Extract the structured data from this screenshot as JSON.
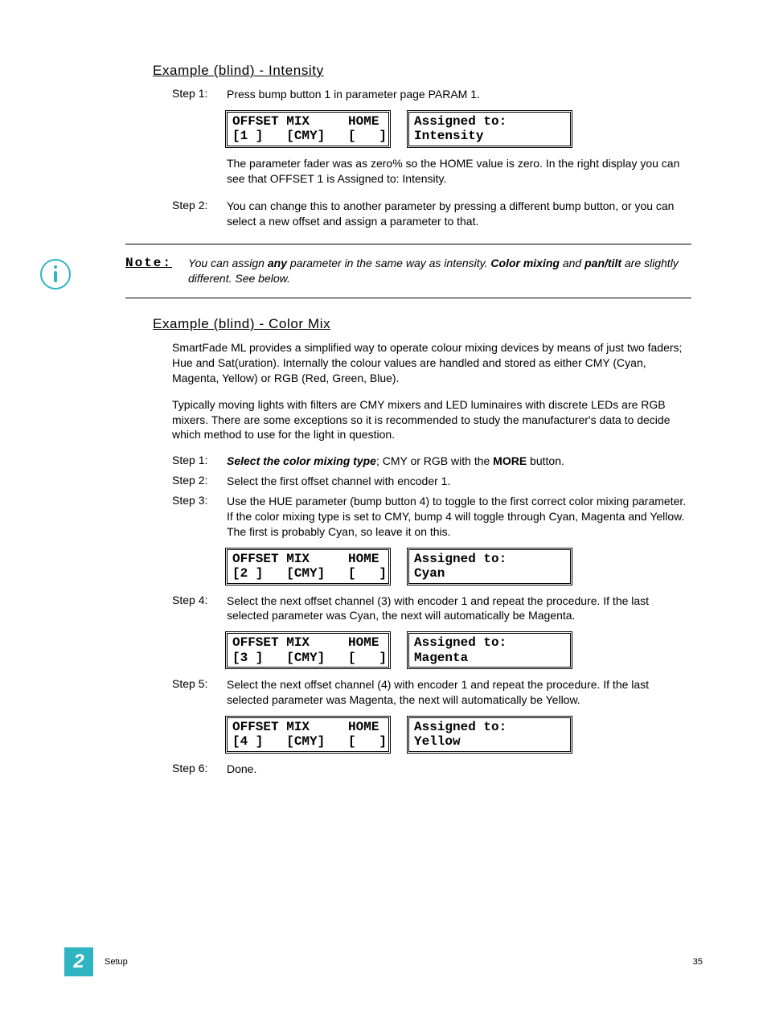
{
  "section1": {
    "heading": "Example (blind) - Intensity",
    "steps": {
      "s1_label": "Step 1:",
      "s1_text": "Press bump button 1 in parameter page PARAM 1.",
      "s2_label": "Step 2:",
      "s2_text": "You can change this to another parameter by pressing a different bump button, or you can select a new offset and assign a parameter to that."
    },
    "lcd1": {
      "left_line1": "OFFSET MIX     HOME",
      "left_line2": "[1 ]   [CMY]   [   ]",
      "right_line1": "Assigned to:",
      "right_line2": "Intensity"
    },
    "after_lcd": "The parameter fader was as zero% so the HOME value is zero. In the right display you can see that OFFSET 1 is Assigned to: Intensity."
  },
  "note": {
    "label": "Note:",
    "pre": "You can assign ",
    "any": "any",
    "mid": " parameter in the same way as intensity. ",
    "cm": "Color mixing",
    "and": " and ",
    "pt": "pan/tilt",
    "post": " are slightly different. See below."
  },
  "section2": {
    "heading": "Example (blind) - Color Mix",
    "para1": "SmartFade ML provides a simplified way to operate colour mixing devices by means of just two faders; Hue and Sat(uration).  Internally the colour values are handled and stored as either CMY (Cyan, Magenta, Yellow) or RGB (Red, Green, Blue).",
    "para2": "Typically moving lights with filters are CMY mixers and LED luminaires with discrete LEDs are RGB mixers.  There are some exceptions so it is recommended to study the manufacturer's data to decide which method to use for the light in question.",
    "steps": {
      "s1_label": "Step 1:",
      "s1_bold": "Select the color mixing type",
      "s1_mid": "; CMY or RGB with the ",
      "s1_more": "MORE",
      "s1_end": " button.",
      "s2_label": "Step 2:",
      "s2_text": "Select the first offset channel with encoder 1.",
      "s3_label": "Step 3:",
      "s3_text": "Use the HUE parameter (bump button 4) to toggle to the first correct color mixing parameter. If the color mixing type is set to CMY, bump 4 will toggle through Cyan, Magenta and Yellow. The first is probably Cyan, so leave it on this.",
      "s4_label": "Step 4:",
      "s4_text": "Select the next offset channel (3) with encoder 1 and repeat the procedure. If the last selected parameter was Cyan, the next will automatically be Magenta.",
      "s5_label": "Step 5:",
      "s5_text": "Select the next offset channel (4) with encoder 1 and repeat the procedure. If the last selected parameter was Magenta, the next will automatically be Yellow.",
      "s6_label": "Step 6:",
      "s6_text": "Done."
    },
    "lcd_cyan": {
      "left_line1": "OFFSET MIX     HOME",
      "left_line2": "[2 ]   [CMY]   [   ]",
      "right_line1": "Assigned to:",
      "right_line2": "Cyan"
    },
    "lcd_magenta": {
      "left_line1": "OFFSET MIX     HOME",
      "left_line2": "[3 ]   [CMY]   [   ]",
      "right_line1": "Assigned to:",
      "right_line2": "Magenta"
    },
    "lcd_yellow": {
      "left_line1": "OFFSET MIX     HOME",
      "left_line2": "[4 ]   [CMY]   [   ]",
      "right_line1": "Assigned to:",
      "right_line2": "Yellow"
    }
  },
  "footer": {
    "chapter": "2",
    "section": "Setup",
    "page": "35"
  }
}
